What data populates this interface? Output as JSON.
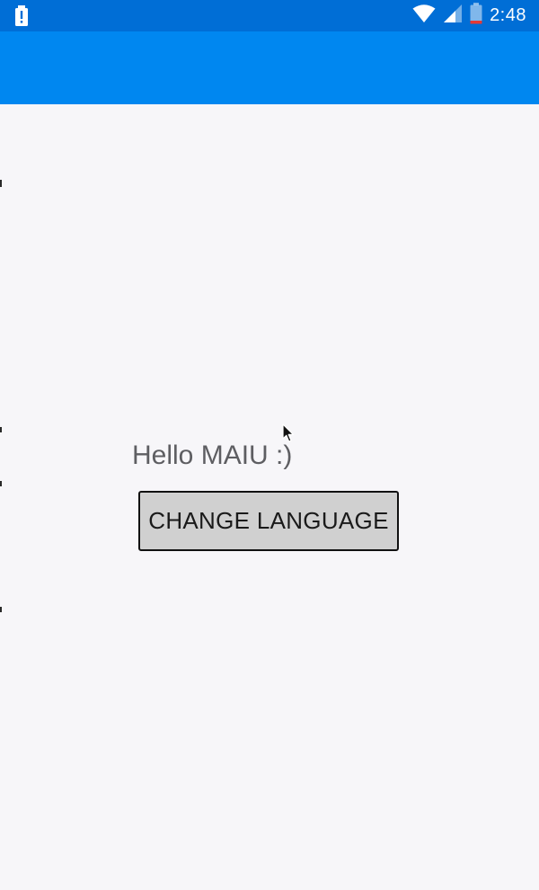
{
  "status_bar": {
    "time": "2:48",
    "icons": [
      "alert-battery-icon",
      "wifi-icon",
      "cell-signal-icon",
      "battery-icon"
    ]
  },
  "app_bar": {
    "title": ""
  },
  "main": {
    "greeting": "Hello MAIU :)",
    "button_label": "CHANGE LANGUAGE"
  },
  "colors": {
    "status_bar": "#006ed6",
    "app_bar": "#0087f0",
    "background": "#f7f6f9",
    "button": "#d0d0d0",
    "greeting_text": "#5e5e62"
  }
}
